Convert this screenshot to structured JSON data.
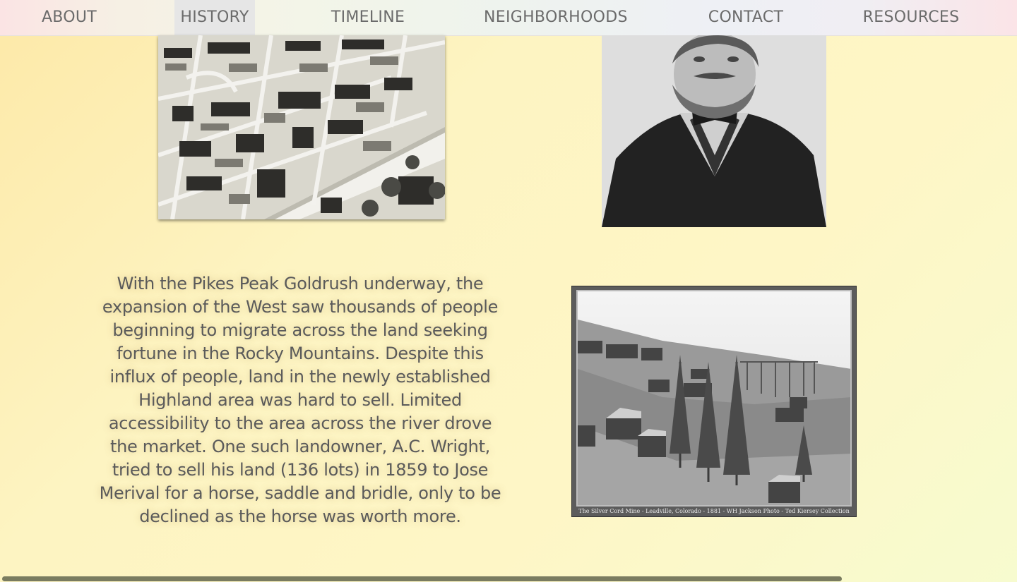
{
  "nav": {
    "items": [
      {
        "label": "ABOUT"
      },
      {
        "label": "HISTORY",
        "active": true
      },
      {
        "label": "TIMELINE"
      },
      {
        "label": "NEIGHBORHOODS"
      },
      {
        "label": "CONTACT"
      },
      {
        "label": "RESOURCES"
      }
    ]
  },
  "main": {
    "story_text": "With the Pikes Peak Goldrush underway, the expansion of the West saw thousands of people beginning to migrate across the land seeking fortune in the Rocky Mountains. Despite this influx of people, land in the newly established Highland area was hard to sell. Limited accessibility to the area across the river drove the market. One such landowner, A.C. Wright, tried to sell his land (136 lots) in 1859 to Jose Merival for a horse, saddle and bridle, only to be declined as the horse was worth more.",
    "mine_photo": {
      "caption": "The Silver Cord Mine - Leadville, Colorado - 1881 - WH Jackson Photo - Ted Kiersey Collection"
    }
  },
  "colors": {
    "nav_text": "#6b6b6b",
    "nav_active_bg": "#e6e6e6",
    "scrollbar": "#7a7c60"
  }
}
